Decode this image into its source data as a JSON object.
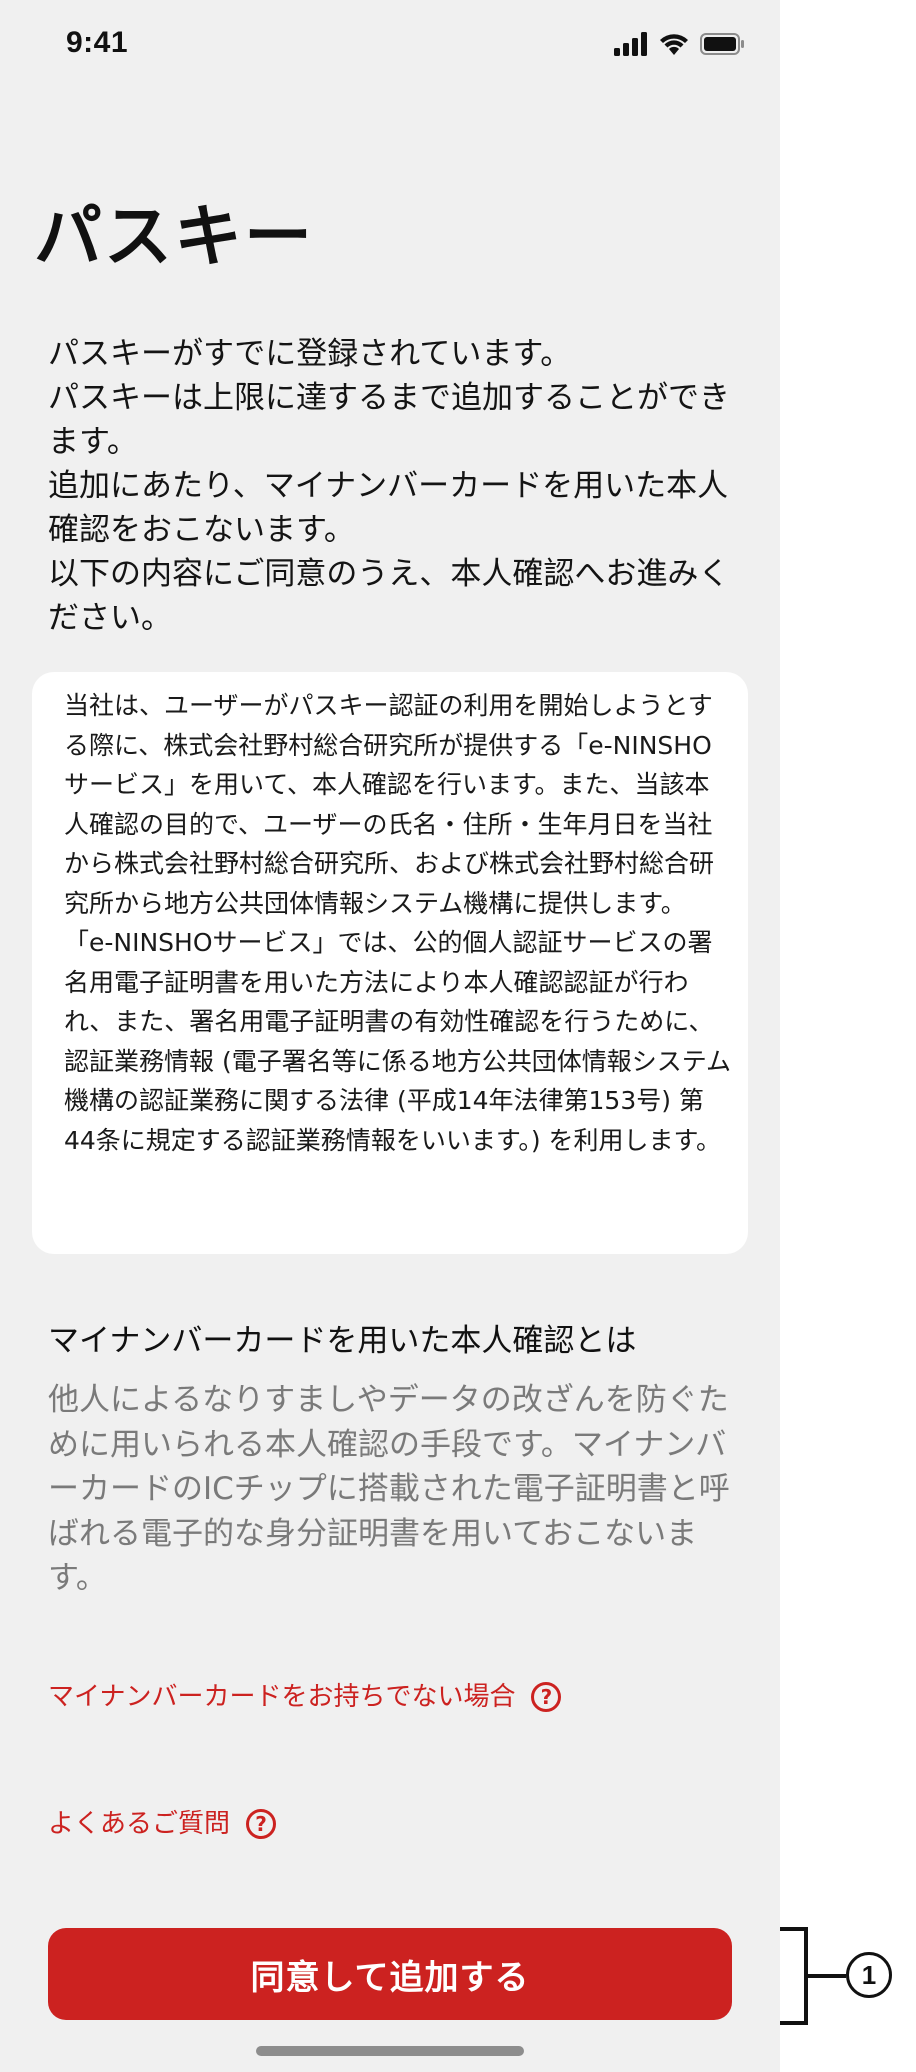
{
  "status_bar": {
    "time": "9:41",
    "icons": [
      "cellular-signal-icon",
      "wifi-icon",
      "battery-icon"
    ]
  },
  "page": {
    "title": "パスキー",
    "intro_lines": [
      "パスキーがすでに登録されています。",
      "パスキーは上限に達するまで追加することができます。",
      "追加にあたり、マイナンバーカードを用いた本人確認をおこないます。",
      "以下の内容にご同意のうえ、本人確認へお進みください。"
    ]
  },
  "terms": {
    "paragraphs": [
      "当社は、ユーザーがパスキー認証の利用を開始しようとする際に、株式会社野村総合研究所が提供する「e-NINSHOサービス」を用いて、本人確認を行います。また、当該本人確認の目的で、ユーザーの氏名・住所・生年月日を当社から株式会社野村総合研究所、および株式会社野村総合研究所から地方公共団体情報システム機構に提供します。",
      "「e-NINSHOサービス」では、公的個人認証サービスの署名用電子証明書を用いた方法により本人確認認証が行われ、また、署名用電子証明書の有効性確認を行うために、認証業務情報 (電子署名等に係る地方公共団体情報システム機構の認証業務に関する法律 (平成14年法律第153号) 第44条に規定する認証業務情報をいいます。) を利用します。"
    ]
  },
  "info": {
    "title": "マイナンバーカードを用いた本人確認とは",
    "body": "他人によるなりすましやデータの改ざんを防ぐために用いられる本人確認の手段です。マイナンバーカードのICチップに搭載された電子証明書と呼ばれる電子的な身分証明書を用いておこないます。"
  },
  "links": {
    "no_card": "マイナンバーカードをお持ちでない場合",
    "faq": "よくあるご質問",
    "help_icon": "question-circle-icon",
    "help_icon_glyph": "?"
  },
  "actions": {
    "agree_label": "同意して追加する"
  },
  "annotation": {
    "number": "1"
  },
  "colors": {
    "accent": "#cc2220",
    "screen_background": "#f0f0f0",
    "card_background": "#ffffff",
    "secondary_text": "#7a7a7a"
  }
}
